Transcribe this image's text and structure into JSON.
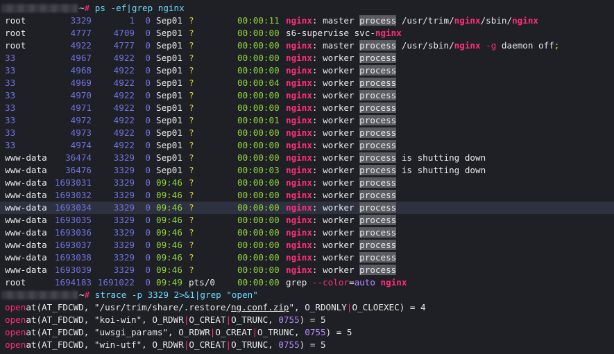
{
  "prompt1": {
    "symbol": "~#",
    "command": "ps -ef|grep nginx"
  },
  "rows": [
    {
      "user": "root",
      "pid": "3329",
      "ppid": "1",
      "c": "0",
      "stime": "Sep01",
      "tty": "?",
      "time": "00:00:11",
      "cmd": [
        {
          "t": "nginx",
          "s": "pink"
        },
        {
          "t": ": master "
        },
        {
          "t": "process",
          "s": "proc"
        },
        {
          "t": " /usr/trim/"
        },
        {
          "t": "nginx",
          "s": "pink"
        },
        {
          "t": "/sbin/"
        },
        {
          "t": "nginx",
          "s": "pink"
        }
      ]
    },
    {
      "user": "root",
      "pid": "4777",
      "ppid": "4709",
      "c": "0",
      "stime": "Sep01",
      "tty": "?",
      "time": "00:00:00",
      "cmd": [
        {
          "t": "s6-supervise svc-"
        },
        {
          "t": "nginx",
          "s": "pink"
        }
      ]
    },
    {
      "user": "root",
      "pid": "4922",
      "ppid": "4777",
      "c": "0",
      "stime": "Sep01",
      "tty": "?",
      "time": "00:00:00",
      "cmd": [
        {
          "t": "nginx",
          "s": "pink"
        },
        {
          "t": ": master "
        },
        {
          "t": "process",
          "s": "proc"
        },
        {
          "t": " /usr/sbin/"
        },
        {
          "t": "nginx",
          "s": "pink"
        },
        {
          "t": " -g",
          "s": "pinkplain"
        },
        {
          "t": " daemon off"
        },
        {
          "t": ";",
          "s": "yellow"
        }
      ]
    },
    {
      "user": "33",
      "pid": "4967",
      "ppid": "4922",
      "c": "0",
      "stime": "Sep01",
      "tty": "?",
      "time": "00:00:00",
      "num": true,
      "cmd": [
        {
          "t": "nginx",
          "s": "pink"
        },
        {
          "t": ": worker "
        },
        {
          "t": "process",
          "s": "proc"
        }
      ]
    },
    {
      "user": "33",
      "pid": "4968",
      "ppid": "4922",
      "c": "0",
      "stime": "Sep01",
      "tty": "?",
      "time": "00:00:00",
      "num": true,
      "cmd": [
        {
          "t": "nginx",
          "s": "pink"
        },
        {
          "t": ": worker "
        },
        {
          "t": "process",
          "s": "proc"
        }
      ]
    },
    {
      "user": "33",
      "pid": "4969",
      "ppid": "4922",
      "c": "0",
      "stime": "Sep01",
      "tty": "?",
      "time": "00:00:04",
      "num": true,
      "cmd": [
        {
          "t": "nginx",
          "s": "pink"
        },
        {
          "t": ": worker "
        },
        {
          "t": "process",
          "s": "proc"
        }
      ]
    },
    {
      "user": "33",
      "pid": "4970",
      "ppid": "4922",
      "c": "0",
      "stime": "Sep01",
      "tty": "?",
      "time": "00:00:00",
      "num": true,
      "cmd": [
        {
          "t": "nginx",
          "s": "pink"
        },
        {
          "t": ": worker "
        },
        {
          "t": "process",
          "s": "proc"
        }
      ]
    },
    {
      "user": "33",
      "pid": "4971",
      "ppid": "4922",
      "c": "0",
      "stime": "Sep01",
      "tty": "?",
      "time": "00:00:00",
      "num": true,
      "cmd": [
        {
          "t": "nginx",
          "s": "pink"
        },
        {
          "t": ": worker "
        },
        {
          "t": "process",
          "s": "proc"
        }
      ]
    },
    {
      "user": "33",
      "pid": "4972",
      "ppid": "4922",
      "c": "0",
      "stime": "Sep01",
      "tty": "?",
      "time": "00:00:01",
      "num": true,
      "cmd": [
        {
          "t": "nginx",
          "s": "pink"
        },
        {
          "t": ": worker "
        },
        {
          "t": "process",
          "s": "proc"
        }
      ]
    },
    {
      "user": "33",
      "pid": "4973",
      "ppid": "4922",
      "c": "0",
      "stime": "Sep01",
      "tty": "?",
      "time": "00:00:00",
      "num": true,
      "cmd": [
        {
          "t": "nginx",
          "s": "pink"
        },
        {
          "t": ": worker "
        },
        {
          "t": "process",
          "s": "proc"
        }
      ]
    },
    {
      "user": "33",
      "pid": "4974",
      "ppid": "4922",
      "c": "0",
      "stime": "Sep01",
      "tty": "?",
      "time": "00:00:00",
      "num": true,
      "cmd": [
        {
          "t": "nginx",
          "s": "pink"
        },
        {
          "t": ": worker "
        },
        {
          "t": "process",
          "s": "proc"
        }
      ]
    },
    {
      "user": "www-data",
      "pid": "36474",
      "ppid": "3329",
      "c": "0",
      "stime": "Sep01",
      "tty": "?",
      "time": "00:00:00",
      "cmd": [
        {
          "t": "nginx",
          "s": "pink"
        },
        {
          "t": ": worker "
        },
        {
          "t": "process",
          "s": "proc"
        },
        {
          "t": " is shutting down"
        }
      ]
    },
    {
      "user": "www-data",
      "pid": "36476",
      "ppid": "3329",
      "c": "0",
      "stime": "Sep01",
      "tty": "?",
      "time": "00:00:03",
      "cmd": [
        {
          "t": "nginx",
          "s": "pink"
        },
        {
          "t": ": worker "
        },
        {
          "t": "process",
          "s": "proc"
        },
        {
          "t": " is shutting down"
        }
      ]
    },
    {
      "user": "www-data",
      "pid": "1693031",
      "ppid": "3329",
      "c": "0",
      "stime": "09:46",
      "tty": "?",
      "time": "00:00:00",
      "green": true,
      "cmd": [
        {
          "t": "nginx",
          "s": "pink"
        },
        {
          "t": ": worker "
        },
        {
          "t": "process",
          "s": "proc"
        }
      ]
    },
    {
      "user": "www-data",
      "pid": "1693032",
      "ppid": "3329",
      "c": "0",
      "stime": "09:46",
      "tty": "?",
      "time": "00:00:00",
      "green": true,
      "cmd": [
        {
          "t": "nginx",
          "s": "pink"
        },
        {
          "t": ": worker "
        },
        {
          "t": "process",
          "s": "proc"
        }
      ]
    },
    {
      "user": "www-data",
      "pid": "1693034",
      "ppid": "3329",
      "c": "0",
      "stime": "09:46",
      "tty": "?",
      "time": "00:00:00",
      "green": true,
      "hl": true,
      "cmd": [
        {
          "t": "nginx",
          "s": "pink"
        },
        {
          "t": ": worker "
        },
        {
          "t": "process",
          "s": "proc"
        }
      ]
    },
    {
      "user": "www-data",
      "pid": "1693035",
      "ppid": "3329",
      "c": "0",
      "stime": "09:46",
      "tty": "?",
      "time": "00:00:00",
      "green": true,
      "cmd": [
        {
          "t": "nginx",
          "s": "pink"
        },
        {
          "t": ": worker "
        },
        {
          "t": "process",
          "s": "proc"
        }
      ]
    },
    {
      "user": "www-data",
      "pid": "1693036",
      "ppid": "3329",
      "c": "0",
      "stime": "09:46",
      "tty": "?",
      "time": "00:00:00",
      "green": true,
      "cmd": [
        {
          "t": "nginx",
          "s": "pink"
        },
        {
          "t": ": worker "
        },
        {
          "t": "process",
          "s": "proc"
        }
      ]
    },
    {
      "user": "www-data",
      "pid": "1693037",
      "ppid": "3329",
      "c": "0",
      "stime": "09:46",
      "tty": "?",
      "time": "00:00:00",
      "green": true,
      "cmd": [
        {
          "t": "nginx",
          "s": "pink"
        },
        {
          "t": ": worker "
        },
        {
          "t": "process",
          "s": "proc"
        }
      ]
    },
    {
      "user": "www-data",
      "pid": "1693038",
      "ppid": "3329",
      "c": "0",
      "stime": "09:46",
      "tty": "?",
      "time": "00:00:00",
      "green": true,
      "cmd": [
        {
          "t": "nginx",
          "s": "pink"
        },
        {
          "t": ": worker "
        },
        {
          "t": "process",
          "s": "proc"
        }
      ]
    },
    {
      "user": "www-data",
      "pid": "1693039",
      "ppid": "3329",
      "c": "0",
      "stime": "09:46",
      "tty": "?",
      "time": "00:00:00",
      "green": true,
      "cmd": [
        {
          "t": "nginx",
          "s": "pink"
        },
        {
          "t": ": worker "
        },
        {
          "t": "process",
          "s": "proc"
        }
      ]
    },
    {
      "user": "root",
      "pid": "1694183",
      "ppid": "1691022",
      "c": "0",
      "stime": "09:49",
      "tty": "pts/0",
      "time": "00:00:00",
      "green": true,
      "whitetty": true,
      "cmd": [
        {
          "t": "grep "
        },
        {
          "t": "--color",
          "s": "pinkplain"
        },
        {
          "t": "="
        },
        {
          "t": "auto",
          "s": "purple"
        },
        {
          "t": " "
        },
        {
          "t": "nginx",
          "s": "pink"
        }
      ]
    }
  ],
  "prompt2": {
    "symbol": "~#",
    "command": "strace -p 3329 2>&1|grep \"open\""
  },
  "strace": [
    [
      {
        "t": "open",
        "s": "kw"
      },
      {
        "t": "at(AT_FDCWD, \"/usr/trim/share/.restore/"
      },
      {
        "t": "ng.conf.zip",
        "s": "ul"
      },
      {
        "t": "\", O_RDONLY"
      },
      {
        "t": "|",
        "s": "op"
      },
      {
        "t": "O_CLOEXEC) = 4"
      }
    ],
    [
      {
        "t": "open",
        "s": "kw"
      },
      {
        "t": "at(AT_FDCWD, \"koi-win\", O_RDWR"
      },
      {
        "t": "|",
        "s": "op"
      },
      {
        "t": "O_CREAT"
      },
      {
        "t": "|",
        "s": "op"
      },
      {
        "t": "O_TRUNC, "
      },
      {
        "t": "0755",
        "s": "purple"
      },
      {
        "t": ") = 5"
      }
    ],
    [
      {
        "t": "open",
        "s": "kw"
      },
      {
        "t": "at(AT_FDCWD, \"uwsgi_params\", O_RDWR"
      },
      {
        "t": "|",
        "s": "op"
      },
      {
        "t": "O_CREAT"
      },
      {
        "t": "|",
        "s": "op"
      },
      {
        "t": "O_TRUNC, "
      },
      {
        "t": "0755",
        "s": "purple"
      },
      {
        "t": ") = 5"
      }
    ],
    [
      {
        "t": "open",
        "s": "kw"
      },
      {
        "t": "at(AT_FDCWD, \"win-utf\", O_RDWR"
      },
      {
        "t": "|",
        "s": "op"
      },
      {
        "t": "O_CREAT"
      },
      {
        "t": "|",
        "s": "op"
      },
      {
        "t": "O_TRUNC, "
      },
      {
        "t": "0755",
        "s": "purple"
      },
      {
        "t": ") = 5"
      }
    ]
  ]
}
